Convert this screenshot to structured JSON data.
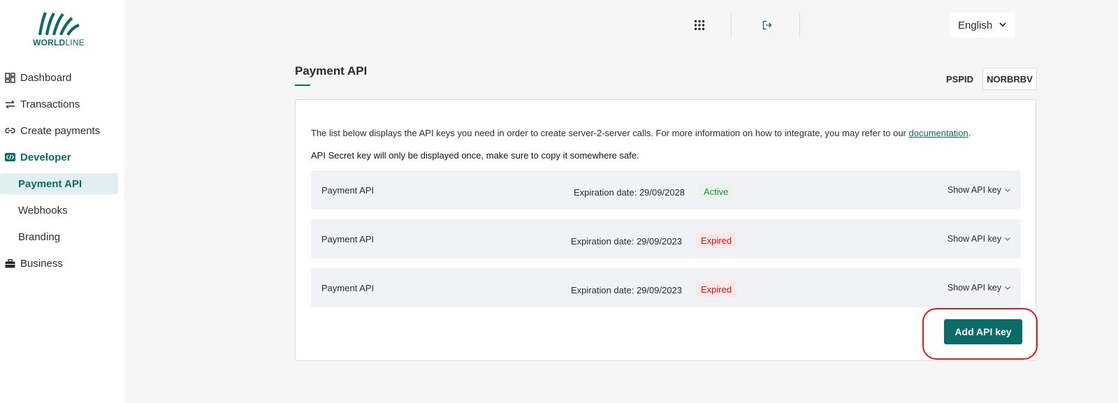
{
  "brand": {
    "name_bold": "WORLD",
    "name_thin": "LINE",
    "color": "#0b6b66"
  },
  "sidebar": {
    "items": [
      {
        "label": "Dashboard",
        "icon": "dashboard-icon"
      },
      {
        "label": "Transactions",
        "icon": "transfer-arrows-icon"
      },
      {
        "label": "Create payments",
        "icon": "link-icon"
      },
      {
        "label": "Developer",
        "icon": "code-icon"
      },
      {
        "label": "Business",
        "icon": "briefcase-icon"
      }
    ],
    "developer_sub": [
      {
        "label": "Payment API",
        "active": true
      },
      {
        "label": "Webhooks",
        "active": false
      },
      {
        "label": "Branding",
        "active": false
      }
    ]
  },
  "topbar": {
    "apps_icon": "grid-icon",
    "logout_icon": "logout-icon",
    "language": "English"
  },
  "page": {
    "title": "Payment API",
    "pspid_label": "PSPID",
    "pspid_value": "NORBRBV"
  },
  "card": {
    "description": "The list below displays the API keys you need in order to create server-2-server calls. For more information on how to integrate, you may refer to our ",
    "doc_link": "documentation",
    "description_end": ".",
    "warning": "API Secret key will only be displayed once, make sure to copy it somewhere safe.",
    "keys": [
      {
        "name": "Payment API",
        "expiration": "Expiration date: 29/09/2028",
        "status": "Active",
        "show_label": "Show API key"
      },
      {
        "name": "Payment API",
        "expiration": "Expiration date: 29/09/2023",
        "status": "Expired",
        "show_label": "Show API key"
      },
      {
        "name": "Payment API",
        "expiration": "Expiration date: 29/09/2023",
        "status": "Expired",
        "show_label": "Show API key"
      }
    ],
    "add_button": "Add API key"
  },
  "colors": {
    "accent": "#0b6b66",
    "active_status": "#1e8a3b",
    "expired_status": "#d4141a",
    "highlight": "#e01b1b"
  }
}
